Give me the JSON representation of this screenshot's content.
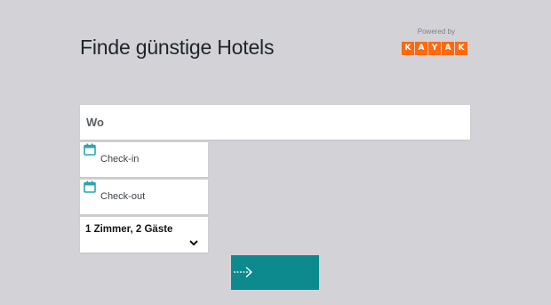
{
  "header": {
    "title": "Finde günstige Hotels",
    "powered_by": "Powered by",
    "brand_letters": [
      "K",
      "A",
      "Y",
      "A",
      "K"
    ]
  },
  "search": {
    "destination_placeholder": "Wo",
    "checkin_label": "Check-in",
    "checkout_label": "Check-out",
    "guests_label": "1 Zimmer, 2 Gäste"
  },
  "icons": {
    "calendar": "calendar-icon",
    "dropdown": "chevron-down-icon",
    "submit": "arrow-right-icon"
  },
  "colors": {
    "background": "#d3d3d7",
    "brand": "#ff690f",
    "accent": "#0d8a8e",
    "calendar_icon": "#2aa6ab"
  }
}
